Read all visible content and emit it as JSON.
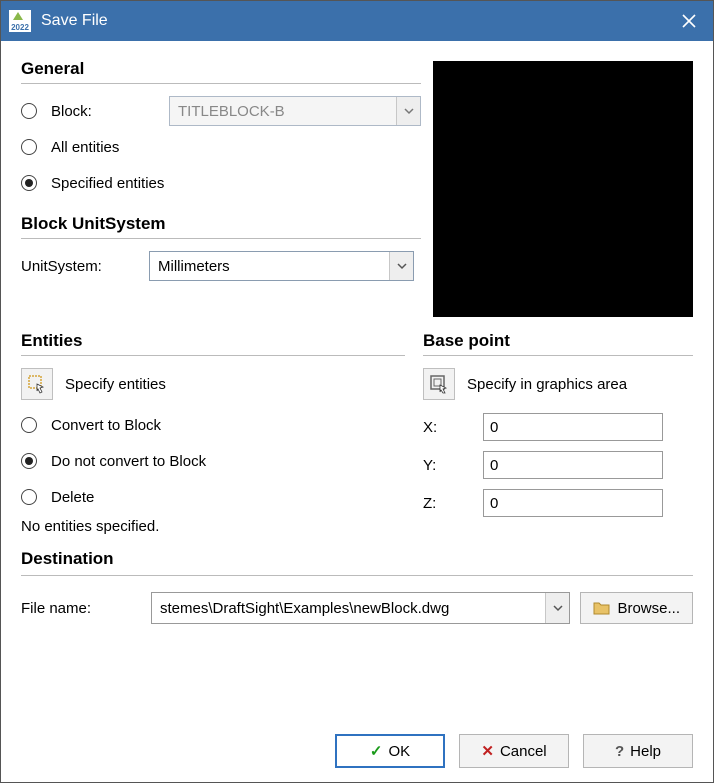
{
  "window": {
    "title": "Save File",
    "app_tag": "2022"
  },
  "general": {
    "heading": "General",
    "block_label": "Block:",
    "block_value": "TITLEBLOCK-B",
    "all_entities_label": "All entities",
    "specified_entities_label": "Specified entities"
  },
  "unit_system": {
    "heading": "Block UnitSystem",
    "label": "UnitSystem:",
    "value": "Millimeters"
  },
  "entities": {
    "heading": "Entities",
    "specify_label": "Specify entities",
    "convert_label": "Convert to Block",
    "do_not_convert_label": "Do not convert to Block",
    "delete_label": "Delete",
    "status": "No entities specified."
  },
  "base_point": {
    "heading": "Base point",
    "specify_label": "Specify in graphics area",
    "x_label": "X:",
    "y_label": "Y:",
    "z_label": "Z:",
    "x_value": "0",
    "y_value": "0",
    "z_value": "0"
  },
  "destination": {
    "heading": "Destination",
    "file_label": "File name:",
    "file_value": "stemes\\DraftSight\\Examples\\newBlock.dwg",
    "browse_label": "Browse..."
  },
  "buttons": {
    "ok": "OK",
    "cancel": "Cancel",
    "help": "Help"
  }
}
